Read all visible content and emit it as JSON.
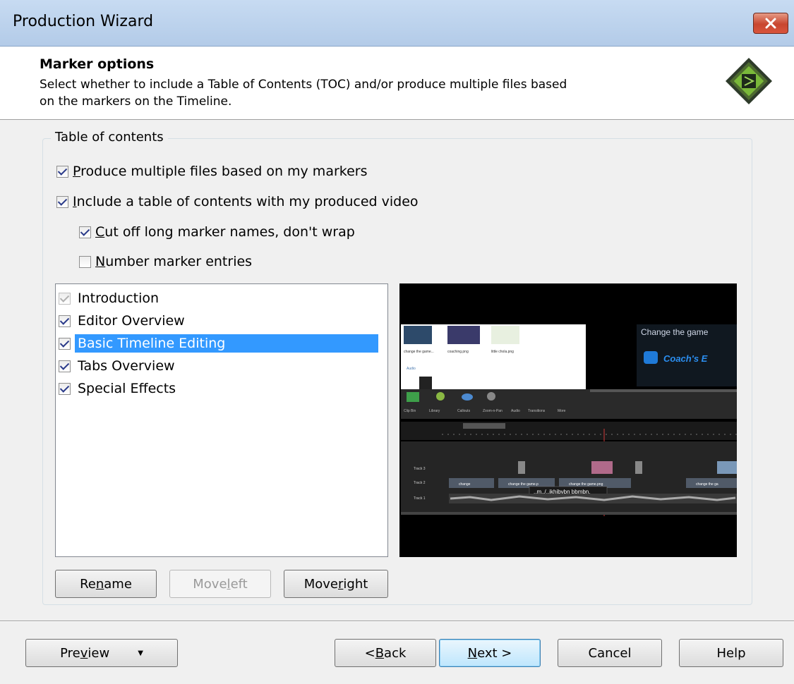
{
  "window": {
    "title": "Production Wizard"
  },
  "header": {
    "title": "Marker options",
    "description": "Select whether to include a Table of Contents (TOC) and/or produce multiple files based on the markers on the Timeline."
  },
  "toc": {
    "group_label": "Table of contents",
    "options": [
      {
        "pre": "",
        "key": "P",
        "post": "roduce multiple files based on my markers",
        "checked": true
      },
      {
        "pre": "",
        "key": "I",
        "post": "nclude a table of contents with my produced video",
        "checked": true
      },
      {
        "pre": "",
        "key": "C",
        "post": "ut off long marker names, don't wrap",
        "checked": true
      },
      {
        "pre": "",
        "key": "N",
        "post": "umber marker entries",
        "checked": false
      }
    ],
    "markers": [
      {
        "label": "Introduction",
        "checked": true,
        "disabled": true
      },
      {
        "label": "Editor Overview",
        "checked": true,
        "disabled": false
      },
      {
        "label": "Basic Timeline Editing",
        "checked": true,
        "disabled": false,
        "selected": true
      },
      {
        "label": "Tabs Overview",
        "checked": true,
        "disabled": false
      },
      {
        "label": "Special Effects",
        "checked": true,
        "disabled": false
      }
    ],
    "buttons": {
      "rename": {
        "pre": "Re",
        "key": "n",
        "post": "ame"
      },
      "move_left": {
        "pre": "Move ",
        "key": "l",
        "post": "eft"
      },
      "move_right": {
        "pre": "Move ",
        "key": "r",
        "post": "ight"
      }
    }
  },
  "preview": {
    "headline": "Change the game",
    "badge": "Coach's E",
    "thumbs": [
      "change the game...",
      "coaching.png",
      "little chola.png"
    ],
    "audio_label": "Audio",
    "tools": [
      "Clip Bin",
      "Library",
      "Callouts",
      "Zoom-n-Pan",
      "Audio",
      "Transitions",
      "More"
    ],
    "tracks": [
      "Track 3",
      "Track 2",
      "Track 1"
    ],
    "track2_clips": [
      "change",
      "change the game.p",
      "change the game.png",
      "change the ga"
    ],
    "tooltip": "..m../..jkhjbvbn bbmbn,"
  },
  "footer": {
    "preview": {
      "pre": "Pre",
      "key": "v",
      "post": "iew"
    },
    "back": {
      "pre": "< ",
      "key": "B",
      "post": "ack"
    },
    "next": {
      "pre": "",
      "key": "N",
      "post": "ext >"
    },
    "cancel": "Cancel",
    "help": "Help"
  },
  "colors": {
    "selection": "#3399ff",
    "titlebar": "#c7dbf2",
    "close": "#c8462f"
  },
  "icons": {
    "close": "close-icon",
    "logo": "camtasia-logo-icon",
    "dropdown": "dropdown-arrow-icon"
  }
}
